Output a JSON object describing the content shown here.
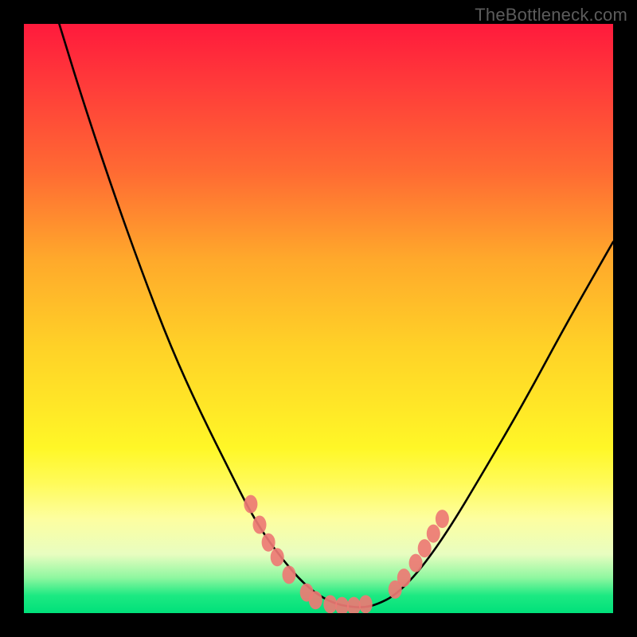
{
  "watermark": "TheBottleneck.com",
  "chart_data": {
    "type": "line",
    "title": "",
    "xlabel": "",
    "ylabel": "",
    "xlim": [
      0,
      100
    ],
    "ylim": [
      0,
      100
    ],
    "series": [
      {
        "name": "bottleneck-curve",
        "color": "#000000",
        "x": [
          6,
          10,
          15,
          20,
          25,
          30,
          35,
          38,
          41,
          44,
          47,
          50,
          53,
          56,
          58,
          60,
          63,
          67,
          72,
          78,
          85,
          92,
          100
        ],
        "y": [
          100,
          87,
          72,
          58,
          45,
          34,
          24,
          18,
          13,
          9,
          5.5,
          3,
          1.5,
          1,
          1,
          1.5,
          3,
          7,
          14,
          24,
          36,
          49,
          63
        ]
      }
    ],
    "markers": [
      {
        "name": "model-points",
        "color": "#ed7a74",
        "points": [
          {
            "x": 38.5,
            "y": 18.5
          },
          {
            "x": 40.0,
            "y": 15.0
          },
          {
            "x": 41.5,
            "y": 12.0
          },
          {
            "x": 43.0,
            "y": 9.5
          },
          {
            "x": 45.0,
            "y": 6.5
          },
          {
            "x": 48.0,
            "y": 3.5
          },
          {
            "x": 49.5,
            "y": 2.2
          },
          {
            "x": 52.0,
            "y": 1.5
          },
          {
            "x": 54.0,
            "y": 1.2
          },
          {
            "x": 56.0,
            "y": 1.2
          },
          {
            "x": 58.0,
            "y": 1.5
          },
          {
            "x": 63.0,
            "y": 4.0
          },
          {
            "x": 64.5,
            "y": 6.0
          },
          {
            "x": 66.5,
            "y": 8.5
          },
          {
            "x": 68.0,
            "y": 11.0
          },
          {
            "x": 69.5,
            "y": 13.5
          },
          {
            "x": 71.0,
            "y": 16.0
          }
        ]
      }
    ]
  }
}
